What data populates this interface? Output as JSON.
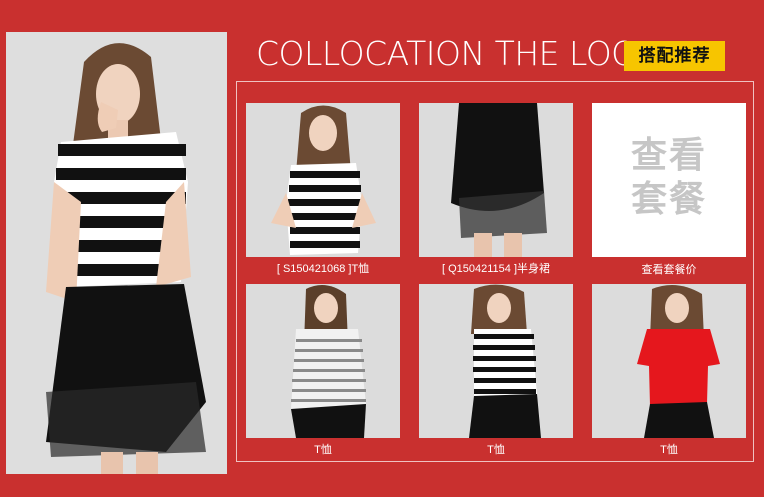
{
  "header": {
    "title": "COLLOCATION THE LOOK",
    "tag": "搭配推荐"
  },
  "main_photo": {
    "alt": ""
  },
  "products": [
    {
      "caption": "[  S150421068 ]T恤"
    },
    {
      "caption": "[  Q150421154 ]半身裙"
    },
    {
      "caption": "查看套餐价",
      "box_text_line1": "查看",
      "box_text_line2": "套餐"
    },
    {
      "caption": "T恤"
    },
    {
      "caption": "T恤"
    },
    {
      "caption": "T恤"
    }
  ],
  "colors": {
    "background": "#c9302f",
    "tag": "#f7c500",
    "white": "#ffffff"
  }
}
